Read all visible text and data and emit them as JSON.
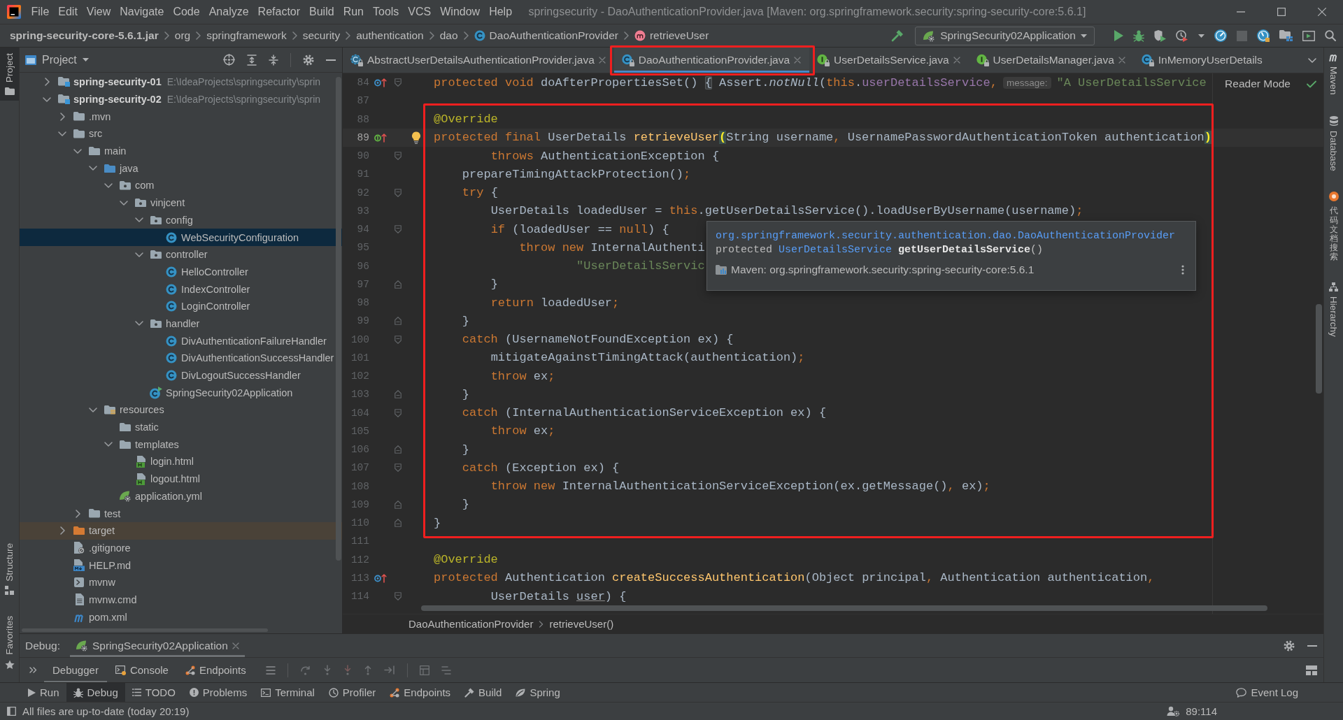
{
  "window": {
    "title": "springsecurity - DaoAuthenticationProvider.java [Maven: org.springframework.security:spring-security-core:5.6.1]"
  },
  "menu": [
    "File",
    "Edit",
    "View",
    "Navigate",
    "Code",
    "Analyze",
    "Refactor",
    "Build",
    "Run",
    "Tools",
    "VCS",
    "Window",
    "Help"
  ],
  "navigation_bar": {
    "path": [
      {
        "label": "spring-security-core-5.6.1.jar",
        "kind": "jar"
      },
      {
        "label": "org",
        "kind": "package"
      },
      {
        "label": "springframework",
        "kind": "package"
      },
      {
        "label": "security",
        "kind": "package"
      },
      {
        "label": "authentication",
        "kind": "package"
      },
      {
        "label": "dao",
        "kind": "package"
      },
      {
        "label": "DaoAuthenticationProvider",
        "kind": "class"
      },
      {
        "label": "retrieveUser",
        "kind": "method"
      }
    ],
    "run_configuration": "SpringSecurity02Application"
  },
  "left_strip": {
    "top": [
      {
        "label": "Project",
        "kind": "project",
        "selected": true
      }
    ],
    "bottom": [
      {
        "label": "Structure",
        "kind": "structure",
        "selected": false
      },
      {
        "label": "Favorites",
        "kind": "favorites",
        "selected": false
      }
    ]
  },
  "project_panel": {
    "title": "Project",
    "tree": [
      {
        "label": "spring-security-01",
        "path": "E:\\IdeaProjects\\springsecurity\\sprin",
        "kind": "module",
        "expanded": false,
        "selected": false
      },
      {
        "label": "spring-security-02",
        "path": "E:\\IdeaProjects\\springsecurity\\sprin",
        "kind": "module",
        "expanded": true,
        "selected": false,
        "children": [
          {
            "label": ".mvn",
            "kind": "folder",
            "expanded": false,
            "selected": false
          },
          {
            "label": "src",
            "kind": "folder",
            "expanded": true,
            "selected": false,
            "children": [
              {
                "label": "main",
                "kind": "folder",
                "expanded": true,
                "selected": false,
                "children": [
                  {
                    "label": "java",
                    "kind": "source-root",
                    "expanded": true,
                    "selected": false,
                    "children": [
                      {
                        "label": "com",
                        "kind": "package",
                        "expanded": true,
                        "selected": false,
                        "children": [
                          {
                            "label": "vinjcent",
                            "kind": "package",
                            "expanded": true,
                            "selected": false,
                            "children": [
                              {
                                "label": "config",
                                "kind": "package",
                                "expanded": true,
                                "selected": false,
                                "children": [
                                  {
                                    "label": "WebSecurityConfiguration",
                                    "kind": "class",
                                    "selected": true
                                  }
                                ]
                              },
                              {
                                "label": "controller",
                                "kind": "package",
                                "expanded": true,
                                "selected": false,
                                "children": [
                                  {
                                    "label": "HelloController",
                                    "kind": "class",
                                    "selected": false
                                  },
                                  {
                                    "label": "IndexController",
                                    "kind": "class",
                                    "selected": false
                                  },
                                  {
                                    "label": "LoginController",
                                    "kind": "class",
                                    "selected": false
                                  }
                                ]
                              },
                              {
                                "label": "handler",
                                "kind": "package",
                                "expanded": true,
                                "selected": false,
                                "children": [
                                  {
                                    "label": "DivAuthenticationFailureHandler",
                                    "kind": "class",
                                    "selected": false
                                  },
                                  {
                                    "label": "DivAuthenticationSuccessHandler",
                                    "kind": "class",
                                    "selected": false
                                  },
                                  {
                                    "label": "DivLogoutSuccessHandler",
                                    "kind": "class",
                                    "selected": false
                                  }
                                ]
                              },
                              {
                                "label": "SpringSecurity02Application",
                                "kind": "application-class",
                                "selected": false
                              }
                            ]
                          }
                        ]
                      }
                    ]
                  },
                  {
                    "label": "resources",
                    "kind": "resources-root",
                    "expanded": true,
                    "selected": false,
                    "children": [
                      {
                        "label": "static",
                        "kind": "folder",
                        "selected": false
                      },
                      {
                        "label": "templates",
                        "kind": "folder",
                        "expanded": true,
                        "selected": false,
                        "children": [
                          {
                            "label": "login.html",
                            "kind": "html",
                            "selected": false
                          },
                          {
                            "label": "logout.html",
                            "kind": "html",
                            "selected": false
                          }
                        ]
                      },
                      {
                        "label": "application.yml",
                        "kind": "config-file",
                        "selected": false
                      }
                    ]
                  }
                ]
              },
              {
                "label": "test",
                "kind": "folder",
                "expanded": false,
                "selected": false
              }
            ]
          },
          {
            "label": "target",
            "kind": "excluded-folder",
            "expanded": false,
            "selected": false
          },
          {
            "label": ".gitignore",
            "kind": "ignore-file",
            "selected": false
          },
          {
            "label": "HELP.md",
            "kind": "markdown",
            "selected": false
          },
          {
            "label": "mvnw",
            "kind": "script",
            "selected": false
          },
          {
            "label": "mvnw.cmd",
            "kind": "text-file",
            "selected": false
          },
          {
            "label": "pom.xml",
            "kind": "maven-pom",
            "selected": false
          }
        ]
      }
    ]
  },
  "editor": {
    "tabs": [
      {
        "label": "AbstractUserDetailsAuthenticationProvider.java",
        "kind": "abstract-class",
        "selected": false,
        "framed": false,
        "closable": true
      },
      {
        "label": "DaoAuthenticationProvider.java",
        "kind": "class",
        "selected": true,
        "framed": true,
        "closable": true
      },
      {
        "label": "UserDetailsService.java",
        "kind": "interface",
        "selected": false,
        "framed": false,
        "closable": true
      },
      {
        "label": "UserDetailsManager.java",
        "kind": "interface",
        "selected": false,
        "framed": false,
        "closable": true
      },
      {
        "label": "InMemoryUserDetails",
        "kind": "class",
        "selected": false,
        "framed": false,
        "closable": false
      }
    ],
    "reader_mode": "Reader Mode",
    "sections": [
      {
        "kind": "plain",
        "lines": [
          {
            "number": "84",
            "current": false,
            "gutter": [
              {
                "kind": "override-marker"
              },
              {
                "kind": "fold-start"
              }
            ],
            "segments": [
              {
                "text": "protected void ",
                "kind": "keyword"
              },
              {
                "text": "doAfterPropertiesSet() ",
                "kind": "plain"
              },
              {
                "text": "{",
                "kind": "fold"
              },
              {
                "text": " Assert.",
                "kind": "plain"
              },
              {
                "text": "notNull",
                "kind": "static"
              },
              {
                "text": "(",
                "kind": "plain"
              },
              {
                "text": "this",
                "kind": "keyword"
              },
              {
                "text": ".",
                "kind": "plain"
              },
              {
                "text": "userDetailsService",
                "kind": "field"
              },
              {
                "text": ",",
                "kind": "keyword"
              },
              {
                "text": "message:",
                "kind": "hint"
              },
              {
                "text": "\"A UserDetailsService",
                "kind": "string"
              }
            ]
          },
          {
            "number": "87",
            "current": false
          }
        ]
      },
      {
        "kind": "framed",
        "lines": [
          {
            "number": "88",
            "current": false,
            "segments": [
              {
                "text": "@Override",
                "kind": "annotation"
              }
            ]
          },
          {
            "number": "89",
            "current": true,
            "gutter": [
              {
                "kind": "implements-marker"
              },
              {
                "kind": "bulb"
              }
            ],
            "segments": [
              {
                "text": "protected final ",
                "kind": "keyword"
              },
              {
                "text": "UserDetails ",
                "kind": "plain"
              },
              {
                "text": "retrieveUser",
                "kind": "declaration"
              },
              {
                "text": "(",
                "kind": "brace"
              },
              {
                "text": "String username",
                "kind": "plain"
              },
              {
                "text": ", ",
                "kind": "keyword"
              },
              {
                "text": "UsernamePasswordAuthenticationToken authentication",
                "kind": "plain"
              },
              {
                "text": ")",
                "kind": "brace"
              }
            ]
          },
          {
            "number": "90",
            "current": false,
            "gutter": [
              {
                "kind": "fold-start"
              }
            ],
            "segments": [
              {
                "text": "        throws ",
                "kind": "keyword"
              },
              {
                "text": "AuthenticationException {",
                "kind": "plain"
              }
            ]
          },
          {
            "number": "91",
            "current": false,
            "segments": [
              {
                "text": "    prepareTimingAttackProtection()",
                "kind": "plain"
              },
              {
                "text": ";",
                "kind": "keyword"
              }
            ]
          },
          {
            "number": "92",
            "current": false,
            "gutter": [
              {
                "kind": "fold-start"
              }
            ],
            "segments": [
              {
                "text": "    try ",
                "kind": "keyword"
              },
              {
                "text": "{",
                "kind": "plain"
              }
            ]
          },
          {
            "number": "93",
            "current": false,
            "segments": [
              {
                "text": "        UserDetails loadedUser = ",
                "kind": "plain"
              },
              {
                "text": "this",
                "kind": "keyword"
              },
              {
                "text": ".getUserDetailsService().loadUserByUsername(username)",
                "kind": "plain"
              },
              {
                "text": ";",
                "kind": "keyword"
              }
            ]
          },
          {
            "number": "94",
            "current": false,
            "gutter": [
              {
                "kind": "fold-start"
              }
            ],
            "segments": [
              {
                "text": "        if ",
                "kind": "keyword"
              },
              {
                "text": "(loadedUser == ",
                "kind": "plain"
              },
              {
                "text": "null",
                "kind": "keyword"
              },
              {
                "text": ") {",
                "kind": "plain"
              }
            ]
          },
          {
            "number": "95",
            "current": false,
            "segments": [
              {
                "text": "            throw new ",
                "kind": "keyword"
              },
              {
                "text": "InternalAuthenti",
                "kind": "plain"
              }
            ]
          },
          {
            "number": "96",
            "current": false,
            "segments": [
              {
                "text": "                    \"UserDetailsServic",
                "kind": "string"
              }
            ]
          },
          {
            "number": "97",
            "current": false,
            "gutter": [
              {
                "kind": "fold-end"
              }
            ],
            "segments": [
              {
                "text": "        }",
                "kind": "plain"
              }
            ]
          },
          {
            "number": "98",
            "current": false,
            "segments": [
              {
                "text": "        return ",
                "kind": "keyword"
              },
              {
                "text": "loadedUser",
                "kind": "plain"
              },
              {
                "text": ";",
                "kind": "keyword"
              }
            ]
          },
          {
            "number": "99",
            "current": false,
            "gutter": [
              {
                "kind": "fold-end"
              }
            ],
            "segments": [
              {
                "text": "    }",
                "kind": "plain"
              }
            ]
          },
          {
            "number": "100",
            "current": false,
            "gutter": [
              {
                "kind": "fold-start"
              }
            ],
            "segments": [
              {
                "text": "    catch ",
                "kind": "keyword"
              },
              {
                "text": "(UsernameNotFoundException ex) {",
                "kind": "plain"
              }
            ]
          },
          {
            "number": "101",
            "current": false,
            "segments": [
              {
                "text": "        mitigateAgainstTimingAttack(authentication)",
                "kind": "plain"
              },
              {
                "text": ";",
                "kind": "keyword"
              }
            ]
          },
          {
            "number": "102",
            "current": false,
            "segments": [
              {
                "text": "        throw ",
                "kind": "keyword"
              },
              {
                "text": "ex",
                "kind": "plain"
              },
              {
                "text": ";",
                "kind": "keyword"
              }
            ]
          },
          {
            "number": "103",
            "current": false,
            "gutter": [
              {
                "kind": "fold-end"
              }
            ],
            "segments": [
              {
                "text": "    }",
                "kind": "plain"
              }
            ]
          },
          {
            "number": "104",
            "current": false,
            "gutter": [
              {
                "kind": "fold-start"
              }
            ],
            "segments": [
              {
                "text": "    catch ",
                "kind": "keyword"
              },
              {
                "text": "(InternalAuthenticationServiceException ex) {",
                "kind": "plain"
              }
            ]
          },
          {
            "number": "105",
            "current": false,
            "segments": [
              {
                "text": "        throw ",
                "kind": "keyword"
              },
              {
                "text": "ex",
                "kind": "plain"
              },
              {
                "text": ";",
                "kind": "keyword"
              }
            ]
          },
          {
            "number": "106",
            "current": false,
            "gutter": [
              {
                "kind": "fold-end"
              }
            ],
            "segments": [
              {
                "text": "    }",
                "kind": "plain"
              }
            ]
          },
          {
            "number": "107",
            "current": false,
            "gutter": [
              {
                "kind": "fold-start"
              }
            ],
            "segments": [
              {
                "text": "    catch ",
                "kind": "keyword"
              },
              {
                "text": "(Exception ex) {",
                "kind": "plain"
              }
            ]
          },
          {
            "number": "108",
            "current": false,
            "segments": [
              {
                "text": "        throw new ",
                "kind": "keyword"
              },
              {
                "text": "InternalAuthenticationServiceException(ex.getMessage()",
                "kind": "plain"
              },
              {
                "text": ", ",
                "kind": "keyword"
              },
              {
                "text": "ex)",
                "kind": "plain"
              },
              {
                "text": ";",
                "kind": "keyword"
              }
            ]
          },
          {
            "number": "109",
            "current": false,
            "gutter": [
              {
                "kind": "fold-end"
              }
            ],
            "segments": [
              {
                "text": "    }",
                "kind": "plain"
              }
            ]
          },
          {
            "number": "110",
            "current": false,
            "gutter": [
              {
                "kind": "fold-end"
              }
            ],
            "segments": [
              {
                "text": "}",
                "kind": "plain"
              }
            ]
          }
        ]
      },
      {
        "kind": "plain",
        "lines": [
          {
            "number": "111",
            "current": false
          },
          {
            "number": "112",
            "current": false,
            "segments": [
              {
                "text": "@Override",
                "kind": "annotation"
              }
            ]
          },
          {
            "number": "113",
            "current": false,
            "gutter": [
              {
                "kind": "override-marker"
              }
            ],
            "segments": [
              {
                "text": "protected ",
                "kind": "keyword"
              },
              {
                "text": "Authentication ",
                "kind": "plain"
              },
              {
                "text": "createSuccessAuthentication",
                "kind": "declaration"
              },
              {
                "text": "(Object principal",
                "kind": "plain"
              },
              {
                "text": ", ",
                "kind": "keyword"
              },
              {
                "text": "Authentication authentication",
                "kind": "plain"
              },
              {
                "text": ",",
                "kind": "keyword"
              }
            ]
          },
          {
            "number": "114",
            "current": false,
            "gutter": [
              {
                "kind": "fold-start"
              }
            ],
            "segments": [
              {
                "text": "        UserDetails ",
                "kind": "plain"
              },
              {
                "text": "user",
                "kind": "underlined"
              },
              {
                "text": ") {",
                "kind": "plain"
              }
            ]
          }
        ]
      }
    ],
    "quick_doc": {
      "qualified_name": "org.springframework.security.authentication.dao.DaoAuthenticationProvider",
      "signature": [
        {
          "text": "protected ",
          "kind": "plain"
        },
        {
          "text": "UserDetailsService ",
          "kind": "link"
        },
        {
          "text": "getUserDetailsService",
          "kind": "bold"
        },
        {
          "text": "()",
          "kind": "plain"
        }
      ],
      "library": "Maven: org.springframework.security:spring-security-core:5.6.1"
    },
    "breadcrumbs": [
      "DaoAuthenticationProvider",
      "retrieveUser()"
    ]
  },
  "right_strip": [
    {
      "label": "Maven",
      "kind": "maven",
      "selected": false
    },
    {
      "label": "Database",
      "kind": "database",
      "selected": false
    },
    {
      "label": "代码文档搜索",
      "kind": "plugin",
      "selected": false
    },
    {
      "label": "Hierarchy",
      "kind": "hierarchy",
      "selected": false
    }
  ],
  "debug_panel": {
    "label": "Debug:",
    "session": "SpringSecurity02Application",
    "tabs": [
      {
        "label": "Debugger",
        "kind": "debugger",
        "selected": true
      },
      {
        "label": "Console",
        "kind": "console",
        "selected": false
      },
      {
        "label": "Endpoints",
        "kind": "endpoints",
        "selected": false
      }
    ]
  },
  "tool_window_bar": {
    "items": [
      {
        "label": "Run",
        "kind": "run",
        "selected": false
      },
      {
        "label": "Debug",
        "kind": "debug",
        "selected": true
      },
      {
        "label": "TODO",
        "kind": "todo",
        "selected": false
      },
      {
        "label": "Problems",
        "kind": "problems",
        "selected": false
      },
      {
        "label": "Terminal",
        "kind": "terminal",
        "selected": false
      },
      {
        "label": "Profiler",
        "kind": "profiler",
        "selected": false
      },
      {
        "label": "Endpoints",
        "kind": "endpoints",
        "selected": false
      },
      {
        "label": "Build",
        "kind": "build",
        "selected": false
      },
      {
        "label": "Spring",
        "kind": "spring",
        "selected": false
      }
    ],
    "event_log": "Event Log"
  },
  "status_bar": {
    "message": "All files are up-to-date (today 20:19)",
    "caret_position": "89:114"
  }
}
